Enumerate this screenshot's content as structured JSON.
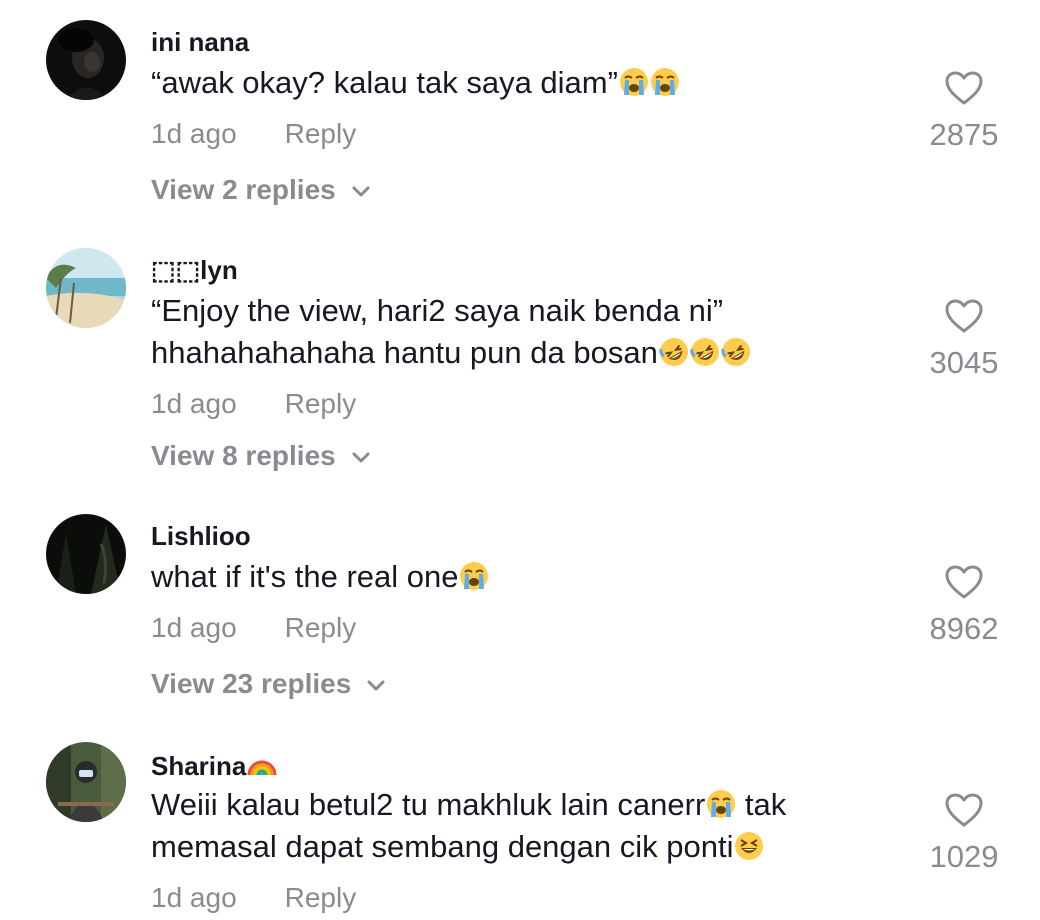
{
  "comments": [
    {
      "username": "ini nana",
      "text": "“awak okay? kalau tak saya diam”",
      "emojis": [
        "loudly-crying-emoji",
        "loudly-crying-emoji"
      ],
      "time": "1d ago",
      "reply_label": "Reply",
      "view_replies": "View 2 replies",
      "likes": "2875",
      "avatar": "dark-portrait-avatar"
    },
    {
      "username": "⬚⬚lyn",
      "text_line1": "“Enjoy the view, hari2 saya naik benda ni”",
      "text_line2": "hhahahahahaha hantu pun da bosan",
      "emojis": [
        "rolling-laughing-emoji",
        "rolling-laughing-emoji",
        "rolling-laughing-emoji"
      ],
      "time": "1d ago",
      "reply_label": "Reply",
      "view_replies": "View 8 replies",
      "likes": "3045",
      "avatar": "beach-avatar"
    },
    {
      "username": "Lishlioo",
      "text": "what if it's the real one",
      "emojis": [
        "loudly-crying-emoji"
      ],
      "time": "1d ago",
      "reply_label": "Reply",
      "view_replies": "View 23 replies",
      "likes": "8962",
      "avatar": "dark-forest-avatar"
    },
    {
      "username": "Sharina",
      "username_emoji": "rainbow-emoji",
      "text_line1a": "Weiii kalau betul2 tu makhluk lain canerr",
      "text_line1b": " tak",
      "text_line2": "memasal dapat sembang dengan cik ponti",
      "emojis_inline": [
        "loudly-crying-emoji"
      ],
      "emojis_end": [
        "grinning-squinting-emoji"
      ],
      "time": "1d ago",
      "reply_label": "Reply",
      "likes": "1029",
      "avatar": "person-outdoor-avatar"
    }
  ],
  "colors": {
    "primary_text": "#161823",
    "secondary_text": "#8a8b91",
    "background": "#ffffff"
  },
  "icons": {
    "like": "heart-outline-icon",
    "expand": "chevron-down-icon"
  }
}
